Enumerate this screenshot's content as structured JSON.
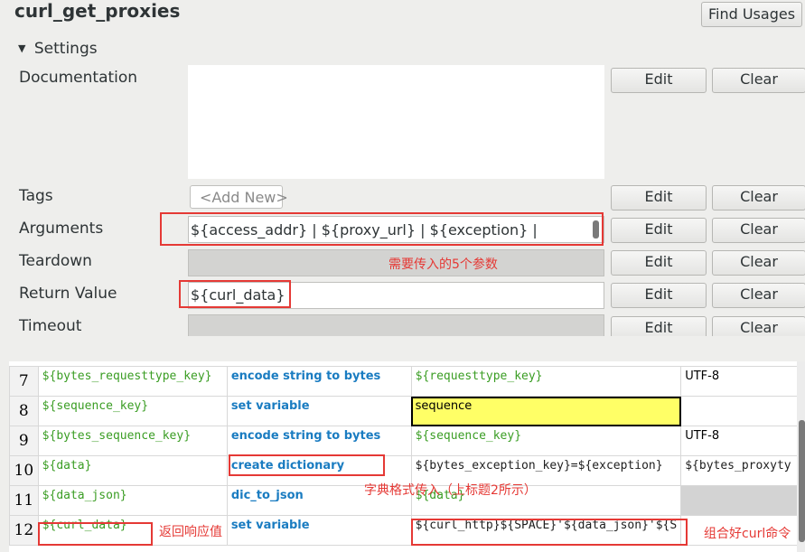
{
  "keyword": {
    "title": "curl_get_proxies",
    "find_usages_label": "Find Usages"
  },
  "settings": {
    "toggle_label": "Settings",
    "documentation": {
      "label": "Documentation",
      "value": "",
      "edit_label": "Edit",
      "clear_label": "Clear"
    },
    "tags": {
      "label": "Tags",
      "placeholder": "<Add New>",
      "edit_label": "Edit",
      "clear_label": "Clear"
    },
    "arguments": {
      "label": "Arguments",
      "value": "${access_addr} | ${proxy_url} | ${exception} |",
      "edit_label": "Edit",
      "clear_label": "Clear"
    },
    "teardown": {
      "label": "Teardown",
      "value": "",
      "edit_label": "Edit",
      "clear_label": "Clear"
    },
    "return_value": {
      "label": "Return Value",
      "value": "${curl_data}",
      "edit_label": "Edit",
      "clear_label": "Clear"
    },
    "timeout": {
      "label": "Timeout",
      "value": "",
      "edit_label": "Edit",
      "clear_label": "Clear"
    }
  },
  "annotations": {
    "args_note": "需要传入的5个参数",
    "dict_note": "字典格式传入（上标题2所示）",
    "return_note": "返回响应值",
    "curl_note": "组合好curl命令"
  },
  "steps": [
    {
      "row": "7",
      "c1": "${bytes_requesttype_key}",
      "c2": "encode string to bytes",
      "c3": "${requesttype_key}",
      "c4": "UTF-8"
    },
    {
      "row": "8",
      "c1": "${sequence_key}",
      "c2": "set variable",
      "c3": "sequence",
      "c4": ""
    },
    {
      "row": "9",
      "c1": "${bytes_sequence_key}",
      "c2": "encode string to bytes",
      "c3": "${sequence_key}",
      "c4": "UTF-8"
    },
    {
      "row": "10",
      "c1": "${data}",
      "c2": "create dictionary",
      "c3": "${bytes_exception_key}=${exception}",
      "c4": "${bytes_proxyty"
    },
    {
      "row": "11",
      "c1": "${data_json}",
      "c2": "dic_to_json",
      "c3": "${data}",
      "c4": ""
    },
    {
      "row": "12",
      "c1": "${curl_data}",
      "c2": "set variable",
      "c3": "${curl_http}${SPACE}'${data_json}'${S",
      "c4": ""
    }
  ]
}
